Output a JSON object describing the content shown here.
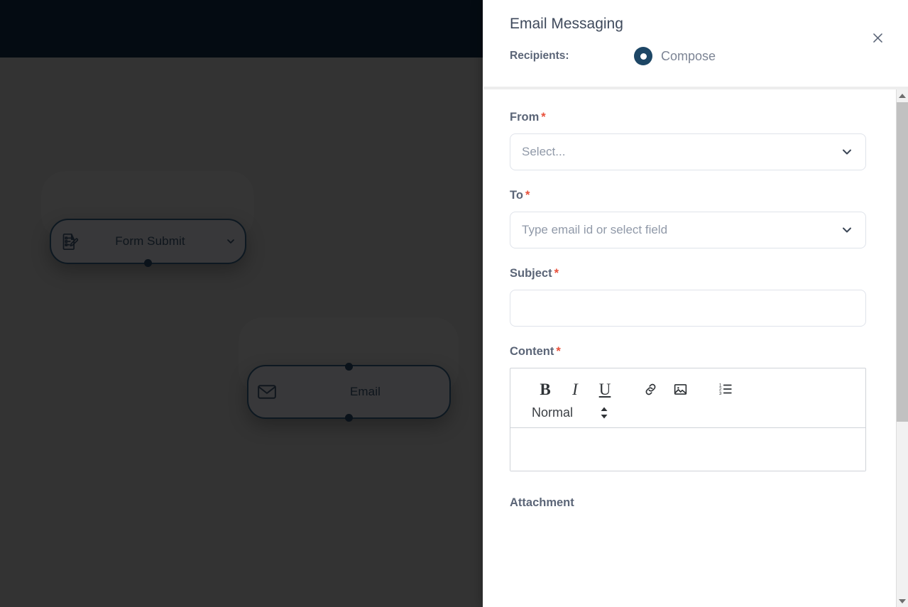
{
  "canvas": {
    "nodes": [
      {
        "id": "form-submit",
        "label": "Form Submit",
        "icon": "form-document-pencil-icon",
        "has_caret": true,
        "ports": [
          "bottom"
        ]
      },
      {
        "id": "email",
        "label": "Email",
        "icon": "envelope-icon",
        "has_caret": false,
        "ports": [
          "top",
          "bottom"
        ]
      }
    ]
  },
  "panel": {
    "title": "Email Messaging",
    "close_icon": "close-icon",
    "recipients": {
      "label": "Recipients:",
      "selected": "Compose",
      "options": [
        "Compose"
      ]
    },
    "fields": {
      "from": {
        "label": "From",
        "required": "*",
        "placeholder": "Select...",
        "value": "",
        "caret_icon": "chevron-down-icon"
      },
      "to": {
        "label": "To",
        "required": "*",
        "placeholder": "Type email id or select field",
        "value": "",
        "caret_icon": "chevron-down-icon"
      },
      "subject": {
        "label": "Subject",
        "required": "*",
        "placeholder": "",
        "value": ""
      },
      "content": {
        "label": "Content",
        "required": "*",
        "value": "",
        "toolbar": {
          "buttons": [
            {
              "name": "bold-icon",
              "glyph": "B",
              "title": "Bold"
            },
            {
              "name": "italic-icon",
              "glyph": "I",
              "title": "Italic"
            },
            {
              "name": "underline-icon",
              "glyph": "U",
              "title": "Underline"
            },
            {
              "name": "link-icon",
              "glyph": "",
              "title": "Link"
            },
            {
              "name": "image-icon",
              "glyph": "",
              "title": "Image"
            },
            {
              "name": "ordered-list-icon",
              "glyph": "",
              "title": "Ordered List"
            }
          ],
          "format": {
            "selected": "Normal",
            "stepper_icon": "up-down-stepper-icon"
          }
        }
      },
      "attachment": {
        "label": "Attachment"
      }
    },
    "scrollbar": {
      "up_icon": "scroll-up-arrow-icon",
      "down_icon": "scroll-down-arrow-icon"
    }
  },
  "colors": {
    "topbar": "#040b12",
    "canvas": "#333333",
    "node_fill": "#38383a",
    "node_border": "#0d1821",
    "accent_radio": "#1d4665",
    "required_star": "#e8503a",
    "label_text": "#5b6577",
    "placeholder_text": "#9099a8",
    "panel_bg": "#ffffff",
    "scrollbar_thumb": "#c1c1c1"
  }
}
